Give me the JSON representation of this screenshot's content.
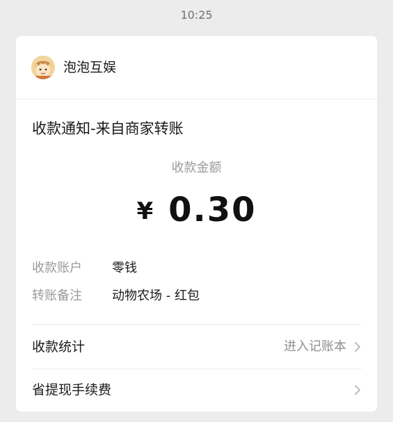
{
  "status_bar": {
    "time": "10:25"
  },
  "merchant": {
    "name": "泡泡互娱",
    "avatar_icon": "cartoon-character-icon"
  },
  "notification": {
    "title": "收款通知-来自商家转账",
    "amount_label": "收款金额",
    "currency_symbol": "¥",
    "amount": "0.30"
  },
  "details": [
    {
      "label": "收款账户",
      "value": "零钱"
    },
    {
      "label": "转账备注",
      "value": "动物农场 - 红包"
    }
  ],
  "links": {
    "stats": {
      "label": "收款统计",
      "hint": "进入记账本"
    },
    "fee": {
      "label": "省提现手续费"
    }
  },
  "colors": {
    "background": "#ececec",
    "card": "#ffffff",
    "text_primary": "#1a1a1a",
    "text_secondary": "#9a9a9a"
  }
}
